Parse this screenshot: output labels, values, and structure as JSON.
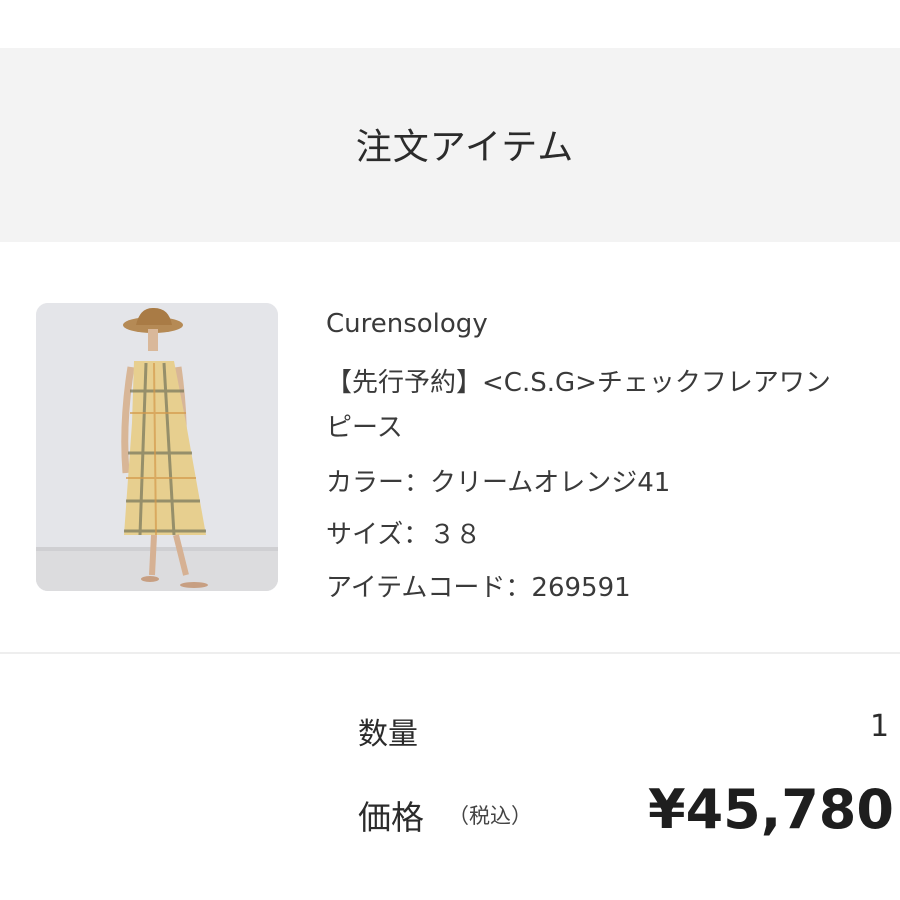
{
  "header": {
    "title": "注文アイテム"
  },
  "item": {
    "brand": "Curensology",
    "name_line1": "【先行予約】<C.S.G>チェックフレアワン",
    "name_line2": "ピース",
    "color": "カラー：クリームオレンジ41",
    "size": "サイズ：３８",
    "code": "アイテムコード：269591"
  },
  "summary": {
    "quantity_label": "数量",
    "quantity_value": "1",
    "price_label": "価格",
    "price_note": "（税込）",
    "price_value": "¥45,780"
  },
  "colors": {
    "header_bg": "#f3f3f3",
    "text": "#333333",
    "divider": "#eeeeee"
  }
}
